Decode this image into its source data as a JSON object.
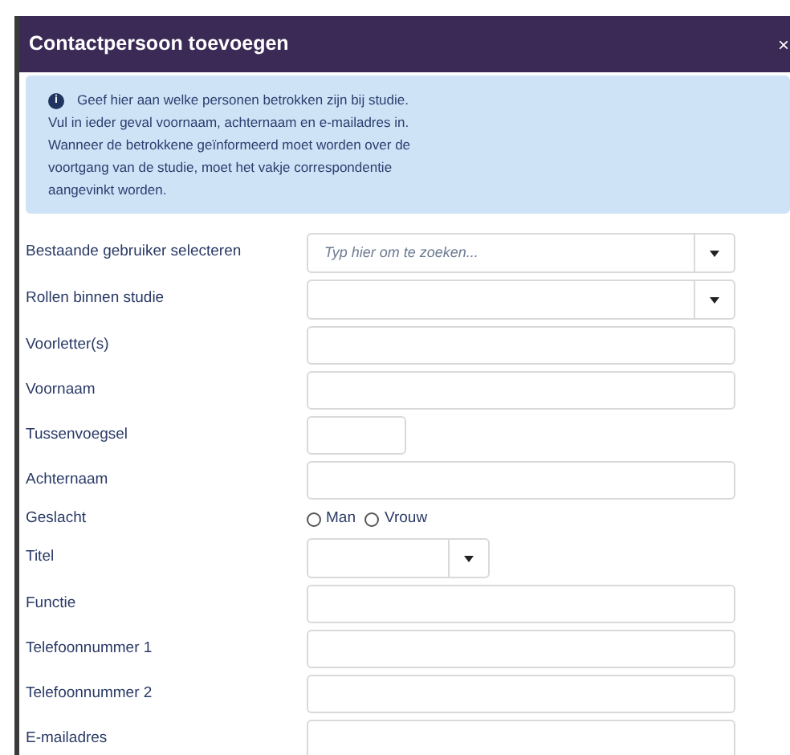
{
  "dialog": {
    "title": "Contactpersoon toevoegen",
    "close": "×"
  },
  "info": {
    "icon": "i",
    "text": "Geef hier aan welke personen betrokken zijn bij studie. Vul in ieder geval voornaam, achternaam en e-mailadres in. Wanneer de betrokkene geïnformeerd moet worden over de voortgang van de studie, moet het vakje correspondentie aangevinkt worden."
  },
  "fields": [
    {
      "kind": "select",
      "label": "Bestaande gebruiker selecteren",
      "placeholder": "Typ hier om te zoeken..."
    },
    {
      "kind": "select",
      "label": "Rollen binnen studie"
    },
    {
      "kind": "text",
      "label": "Voorletter(s)"
    },
    {
      "kind": "text",
      "label": "Voornaam"
    },
    {
      "kind": "shorttext",
      "label": "Tussenvoegsel"
    },
    {
      "kind": "text",
      "label": "Achternaam"
    },
    {
      "kind": "radio",
      "label": "Geslacht",
      "options": [
        {
          "label": "Man",
          "selected": false
        },
        {
          "label": "Vrouw",
          "selected": false
        }
      ]
    },
    {
      "kind": "shortselect",
      "label": "Titel"
    },
    {
      "kind": "text",
      "label": "Functie"
    },
    {
      "kind": "text",
      "label": "Telefoonnummer 1"
    },
    {
      "kind": "text",
      "label": "Telefoonnummer 2"
    },
    {
      "kind": "text",
      "label": "E-mailadres"
    }
  ]
}
